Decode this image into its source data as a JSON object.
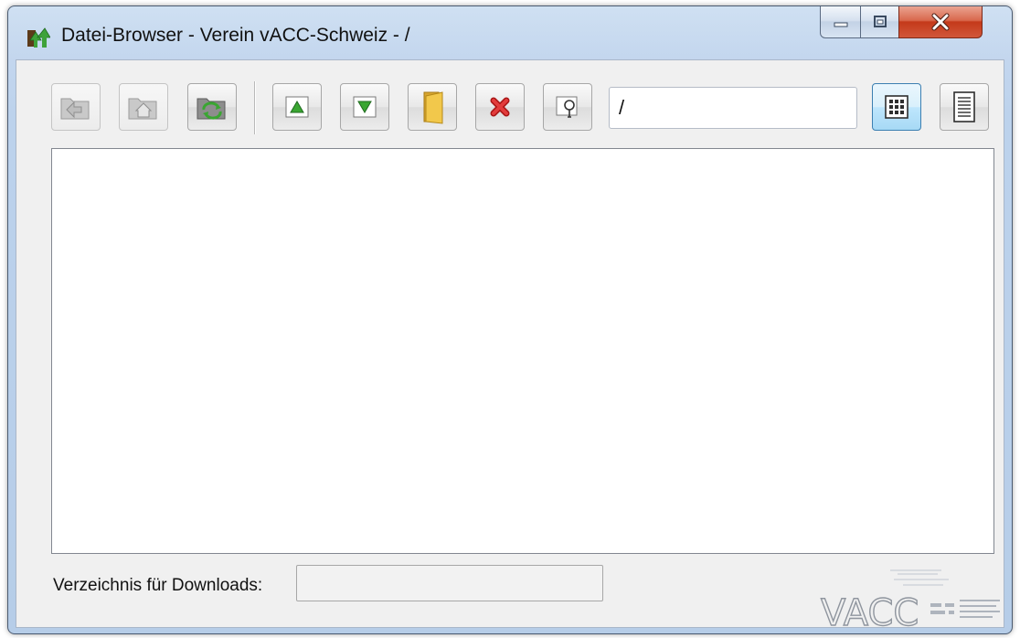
{
  "window": {
    "title": "Datei-Browser - Verein vACC-Schweiz - /",
    "caption_buttons": [
      "minimize",
      "maximize",
      "close"
    ]
  },
  "toolbar": {
    "buttons": [
      {
        "name": "back-button",
        "icon": "folder-back-icon",
        "enabled": false
      },
      {
        "name": "home-button",
        "icon": "folder-home-icon",
        "enabled": false
      },
      {
        "name": "refresh-button",
        "icon": "folder-refresh-icon",
        "enabled": true
      },
      {
        "name": "upload-button",
        "icon": "green-triangle-up-icon",
        "enabled": true
      },
      {
        "name": "download-button",
        "icon": "green-triangle-down-icon",
        "enabled": true
      },
      {
        "name": "new-folder-button",
        "icon": "yellow-folder-icon",
        "enabled": true
      },
      {
        "name": "delete-button",
        "icon": "red-x-icon",
        "enabled": true
      },
      {
        "name": "rename-button",
        "icon": "lightbulb-icon",
        "enabled": true
      }
    ],
    "path": "/",
    "view_modes": [
      {
        "name": "icon-view-button",
        "icon": "grid-view-icon",
        "active": true
      },
      {
        "name": "list-view-button",
        "icon": "list-view-icon",
        "active": false
      }
    ]
  },
  "file_list": {
    "items": []
  },
  "footer": {
    "download_dir_label": "Verzeichnis für Downloads:",
    "download_dir_value": ""
  },
  "watermark": {
    "text": "VACC"
  },
  "colors": {
    "accent_active": "#3c7fb1",
    "close_red": "#c4391a",
    "icon_green": "#3aa632",
    "delete_red": "#d62e2e",
    "folder_yellow": "#e9b93d"
  }
}
